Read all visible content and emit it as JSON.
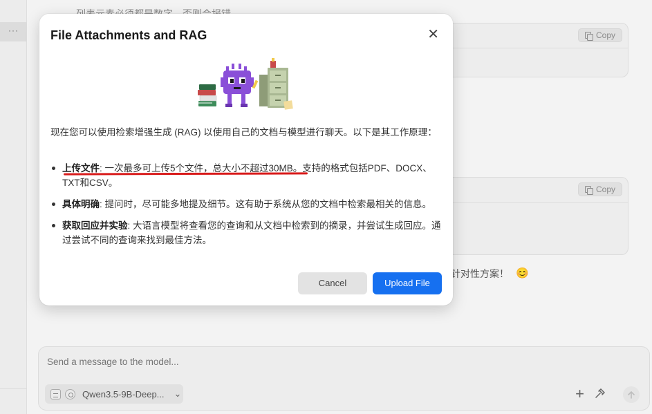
{
  "background": {
    "rail_more_label": "···",
    "partial_text_top": "列表元素必须都是数字，否则会报错",
    "partial_text_bottom": "针对性方案！",
    "emoji": "😊",
    "code_blocks": [
      {
        "copy_label": "Copy"
      },
      {
        "copy_label": "Copy"
      }
    ]
  },
  "composer": {
    "placeholder": "Send a message to the model...",
    "model_name": "Qwen3.5-9B-Deep...",
    "add_icon": "plus-icon",
    "tools_icon": "hammer-icon",
    "send_icon": "arrow-up-icon"
  },
  "modal": {
    "title": "File Attachments and RAG",
    "close_icon": "close-icon",
    "intro": "现在您可以使用检索增强生成 (RAG) 以使用自己的文档与模型进行聊天。以下是其工作原理：",
    "items": [
      {
        "term": "上传文件",
        "text": ": 一次最多可上传5个文件，总大小不超过30MB。支持的格式包括PDF、DOCX、TXT和CSV。"
      },
      {
        "term": "具体明确",
        "text": ": 提问时，尽可能多地提及细节。这有助于系统从您的文档中检索最相关的信息。"
      },
      {
        "term": "获取回应并实验",
        "text": ": 大语言模型将查看您的查询和从文档中检索到的摘录，并尝试生成回应。通过尝试不同的查询来找到最佳方法。"
      }
    ],
    "cancel_label": "Cancel",
    "upload_label": "Upload File"
  },
  "colors": {
    "primary_button": "#1670f0",
    "annotation_underline": "#d81b1b",
    "mascot": "#8a4fd8"
  }
}
